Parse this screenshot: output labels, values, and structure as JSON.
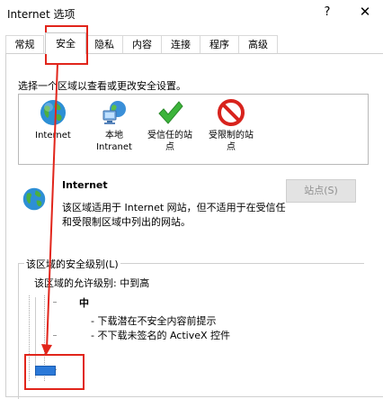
{
  "window": {
    "title": "Internet 选项",
    "help_glyph": "?",
    "close_glyph": "✕"
  },
  "tabs": [
    {
      "label": "常规"
    },
    {
      "label": "安全"
    },
    {
      "label": "隐私"
    },
    {
      "label": "内容"
    },
    {
      "label": "连接"
    },
    {
      "label": "程序"
    },
    {
      "label": "高级"
    }
  ],
  "active_tab": "安全",
  "security": {
    "zone_instruction": "选择一个区域以查看或更改安全设置。",
    "zones": [
      {
        "label": "Internet",
        "icon": "globe-icon"
      },
      {
        "label": "本地\nIntranet",
        "icon": "intranet-icon"
      },
      {
        "label": "受信任的站\n点",
        "icon": "checkmark-icon"
      },
      {
        "label": "受限制的站\n点",
        "icon": "restricted-icon"
      }
    ],
    "selected_zone": {
      "title": "Internet",
      "description": "该区域适用于 Internet 网站，但不适用于在受信任和受限制区域中列出的网站。",
      "icon": "globe-icon"
    },
    "sites_button": "站点(S)",
    "level_group_title": "该区域的安全级别(L)",
    "allowed_levels": "该区域的允许级别: 中到高",
    "level_name": "中",
    "level_descriptions": [
      "- 下载潜在不安全内容前提示",
      "- 不下载未签名的 ActiveX 控件"
    ]
  },
  "colors": {
    "annotation": "#e1251b",
    "slider_thumb": "#2b79d8"
  }
}
